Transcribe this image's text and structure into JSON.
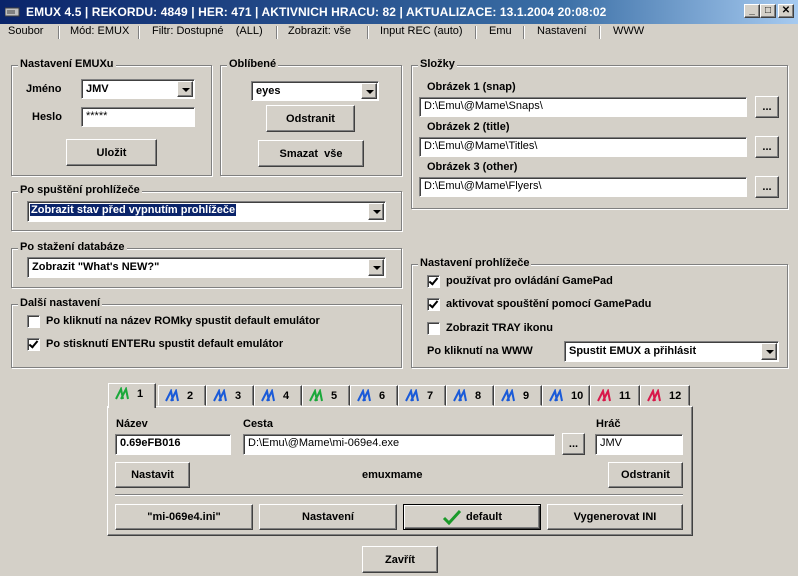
{
  "window": {
    "title": "EMUX 4.5   |   REKORDU: 4849   |   HER: 471   |   AKTIVNICH HRACU: 82   |   AKTUALIZACE: 13.1.2004 20:08:02",
    "minimize": "_",
    "maximize": "□",
    "close": "✕"
  },
  "menu": [
    "Soubor",
    "Mód: EMUX",
    "Filtr: Dostupné    (ALL)",
    "Zobrazit: vše",
    "Input REC (auto)",
    "Emu",
    "Nastavení",
    "WWW"
  ],
  "emux_settings": {
    "legend": "Nastavení EMUXu",
    "name_label": "Jméno",
    "name_value": "JMV",
    "password_label": "Heslo",
    "password_value": "*****",
    "save_label": "Uložit"
  },
  "favorites": {
    "legend": "Oblíbené",
    "selected": "eyes",
    "remove_label": "Odstranit",
    "clear_label": "Smazat  vše"
  },
  "folders": {
    "legend": "Složky",
    "items": [
      {
        "label": "Obrázek 1 (snap)",
        "path": "D:\\Emu\\@Mame\\Snaps\\",
        "browse": "..."
      },
      {
        "label": "Obrázek 2 (title)",
        "path": "D:\\Emu\\@Mame\\Titles\\",
        "browse": "..."
      },
      {
        "label": "Obrázek 3 (other)",
        "path": "D:\\Emu\\@Mame\\Flyers\\",
        "browse": "..."
      }
    ]
  },
  "after_start": {
    "legend": "Po spuštění prohlížeče",
    "selected": "Zobrazit stav před vypnutím prohlížeče"
  },
  "after_download": {
    "legend": "Po stažení databáze",
    "selected": "Zobrazit \"What's NEW?\""
  },
  "other_settings": {
    "legend": "Další nastavení",
    "options": [
      {
        "label": "Po kliknutí na název ROMky spustit default emulátor",
        "checked": false
      },
      {
        "label": "Po stisknutí ENTERu spustit default emulátor",
        "checked": true
      }
    ]
  },
  "browser_settings": {
    "legend": "Nastavení prohlížeče",
    "options": [
      {
        "label": "používat pro ovládání GamePad",
        "checked": true
      },
      {
        "label": "aktivovat spouštění pomocí GamePadu",
        "checked": true
      },
      {
        "label": "Zobrazit TRAY ikonu",
        "checked": false
      }
    ],
    "www_label": "Po kliknutí na WWW",
    "www_selected": "Spustit EMUX a přihlásit"
  },
  "tabs": {
    "items": [
      {
        "label": "1",
        "color": "#1aa83a",
        "active": true
      },
      {
        "label": "2",
        "color": "#1a5ad8"
      },
      {
        "label": "3",
        "color": "#1a5ad8"
      },
      {
        "label": "4",
        "color": "#1a5ad8"
      },
      {
        "label": "5",
        "color": "#1aa83a"
      },
      {
        "label": "6",
        "color": "#1a5ad8"
      },
      {
        "label": "7",
        "color": "#1a5ad8"
      },
      {
        "label": "8",
        "color": "#1a5ad8"
      },
      {
        "label": "9",
        "color": "#1a5ad8"
      },
      {
        "label": "10",
        "color": "#1a5ad8"
      },
      {
        "label": "11",
        "color": "#d8184a"
      },
      {
        "label": "12",
        "color": "#d8184a"
      }
    ]
  },
  "emulator": {
    "name_label": "Název",
    "name_value": "0.69eFB016",
    "path_label": "Cesta",
    "path_value": "D:\\Emu\\@Mame\\mi-069e4.exe",
    "browse": "...",
    "player_label": "Hráč",
    "player_value": "JMV",
    "set_label": "Nastavit",
    "emu_id": "emuxmame",
    "remove_label": "Odstranit",
    "ini_label": "\"mi-069e4.ini\"",
    "settings_label": "Nastavení",
    "default_label": "default",
    "generate_label": "Vygenerovat INI"
  },
  "close_label": "Zavřít"
}
